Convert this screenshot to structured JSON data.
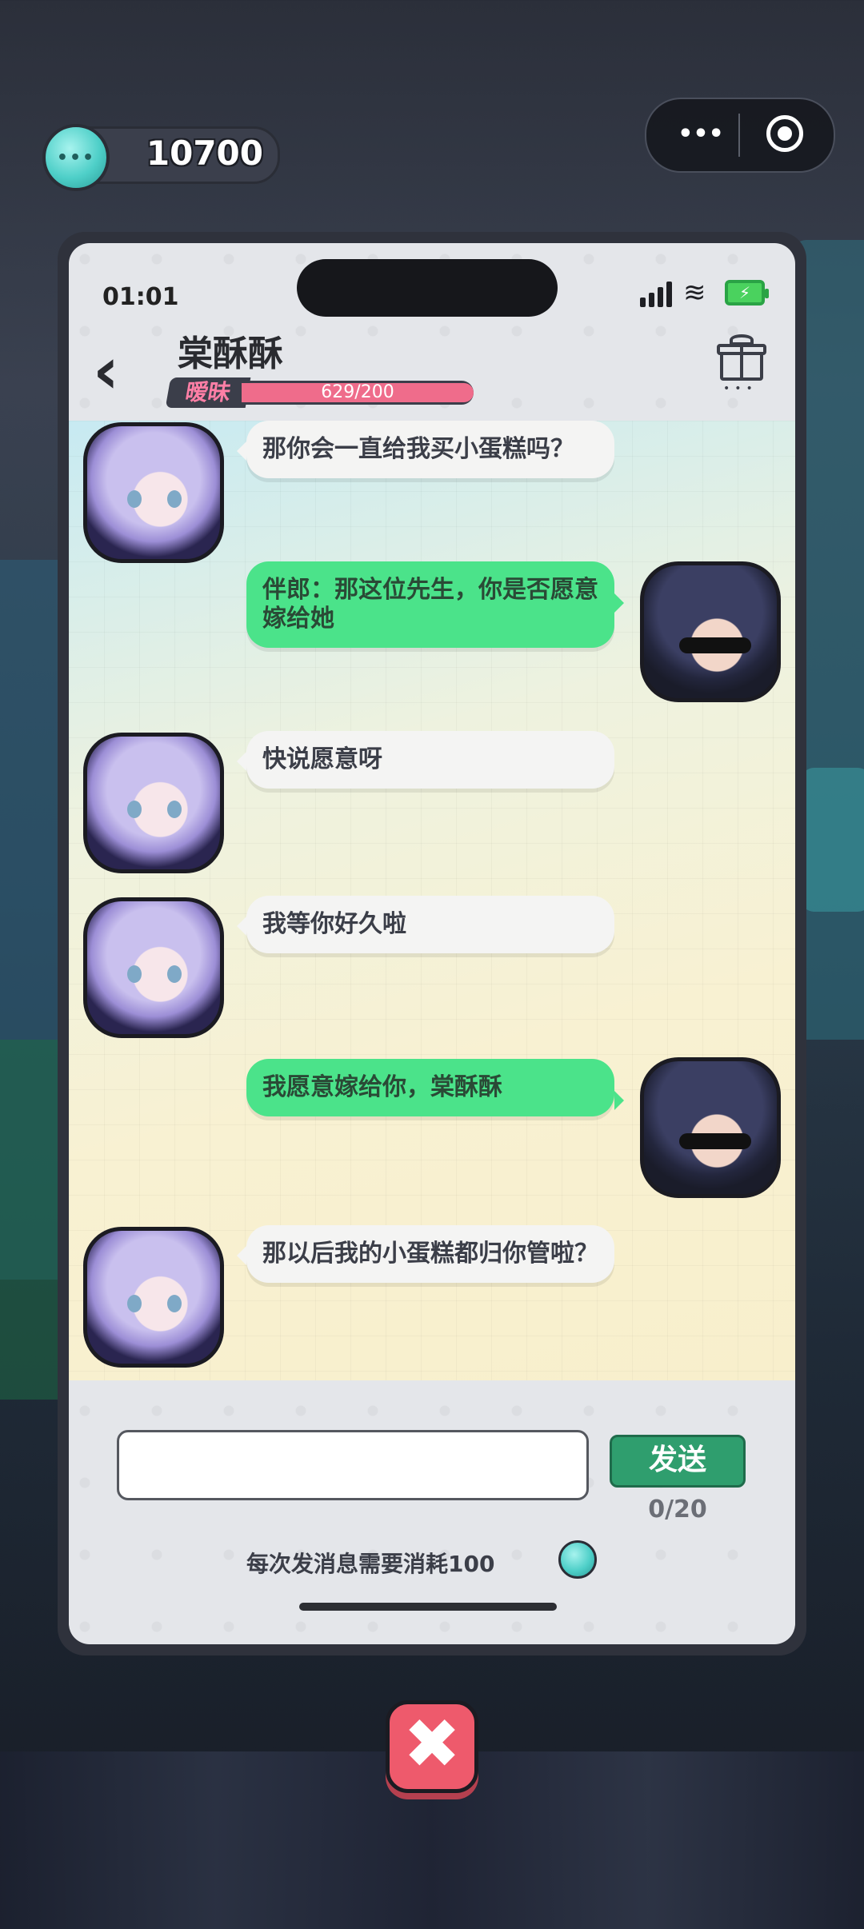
{
  "hud": {
    "currency_value": "10700",
    "currency_icon": "chat-coin-icon",
    "capsule_more": "•••"
  },
  "phone": {
    "status_time": "01:01",
    "battery_glyph": "⚡",
    "wifi_glyph": "≋",
    "contact_name": "棠酥酥",
    "relationship_label": "暧昧",
    "relationship_progress": "629/200",
    "relationship_fill_fraction": 1.0,
    "back_glyph": "‹",
    "gift_dots": "•••"
  },
  "messages": [
    {
      "from": "her",
      "text": "那你会一直给我买小蛋糕吗？"
    },
    {
      "from": "me",
      "text": "伴郎：那这位先生，你是否愿意嫁给她"
    },
    {
      "from": "her",
      "text": "快说愿意呀"
    },
    {
      "from": "her",
      "text": "我等你好久啦"
    },
    {
      "from": "me",
      "text": "我愿意嫁给你，棠酥酥"
    },
    {
      "from": "her",
      "text": "那以后我的小蛋糕都归你管啦？"
    }
  ],
  "composer": {
    "input_value": "",
    "send_label": "发送",
    "counter": "0/20",
    "cost_note": "每次发消息需要消耗100"
  },
  "close_glyph": "✖"
}
